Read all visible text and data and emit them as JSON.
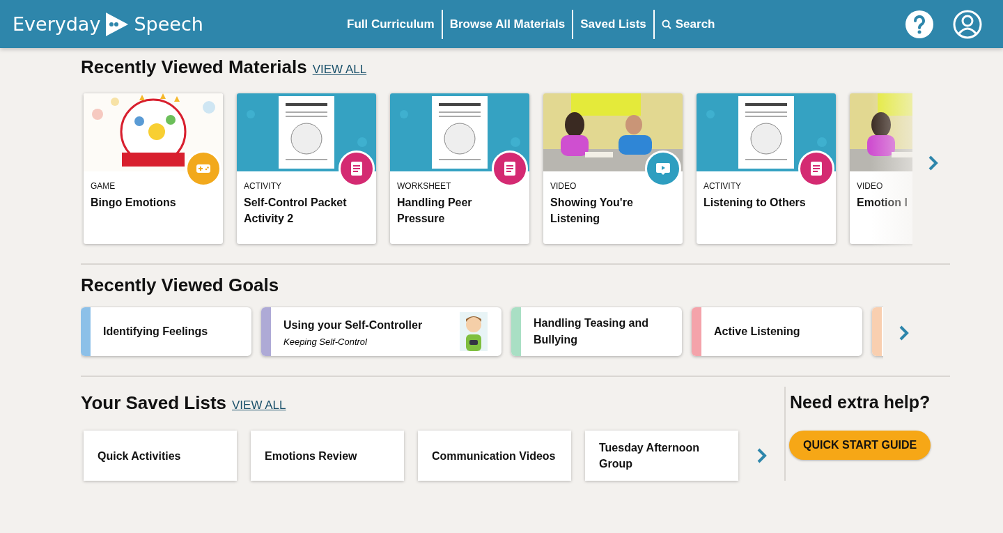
{
  "header": {
    "logo_left": "Everyday",
    "logo_right": "Speech",
    "nav": [
      {
        "label": "Full Curriculum",
        "kind": "link"
      },
      {
        "label": "Browse All Materials",
        "kind": "link"
      },
      {
        "label": "Saved Lists",
        "kind": "link"
      },
      {
        "label": "Search",
        "kind": "search"
      }
    ]
  },
  "materials": {
    "title": "Recently Viewed Materials",
    "view_all": "VIEW ALL",
    "items": [
      {
        "category": "GAME",
        "title": "Bingo Emotions",
        "kind": "game",
        "badge": true
      },
      {
        "category": "ACTIVITY",
        "title": "Self-Control Packet Activity 2",
        "kind": "document",
        "badge": true
      },
      {
        "category": "WORKSHEET",
        "title": "Handling Peer Pressure",
        "kind": "document",
        "badge": true
      },
      {
        "category": "VIDEO",
        "title": "Showing You're Listening",
        "kind": "video",
        "badge": true
      },
      {
        "category": "ACTIVITY",
        "title": "Listening to Others",
        "kind": "document",
        "badge": true
      },
      {
        "category": "VIDEO",
        "title": "Emotion I",
        "kind": "video",
        "badge": false
      }
    ]
  },
  "goals": {
    "title": "Recently Viewed Goals",
    "items": [
      {
        "title": "Identifying Feelings",
        "color": "#8cc0e8"
      },
      {
        "title": "Using your Self-Controller",
        "subtitle": "Keeping Self-Control",
        "color": "#aeaad6",
        "avatar": true
      },
      {
        "title": "Handling Teasing and Bullying",
        "color": "#a9dfc4"
      },
      {
        "title": "Active Listening",
        "color": "#f4a3aa"
      },
      {
        "color": "#f9cfb0"
      }
    ]
  },
  "saved_lists": {
    "title": "Your Saved Lists",
    "view_all": "VIEW ALL",
    "items": [
      "Quick Activities",
      "Emotions Review",
      "Communication Videos",
      "Tuesday Afternoon Group"
    ]
  },
  "help": {
    "title": "Need extra help?",
    "button": "QUICK START GUIDE"
  }
}
